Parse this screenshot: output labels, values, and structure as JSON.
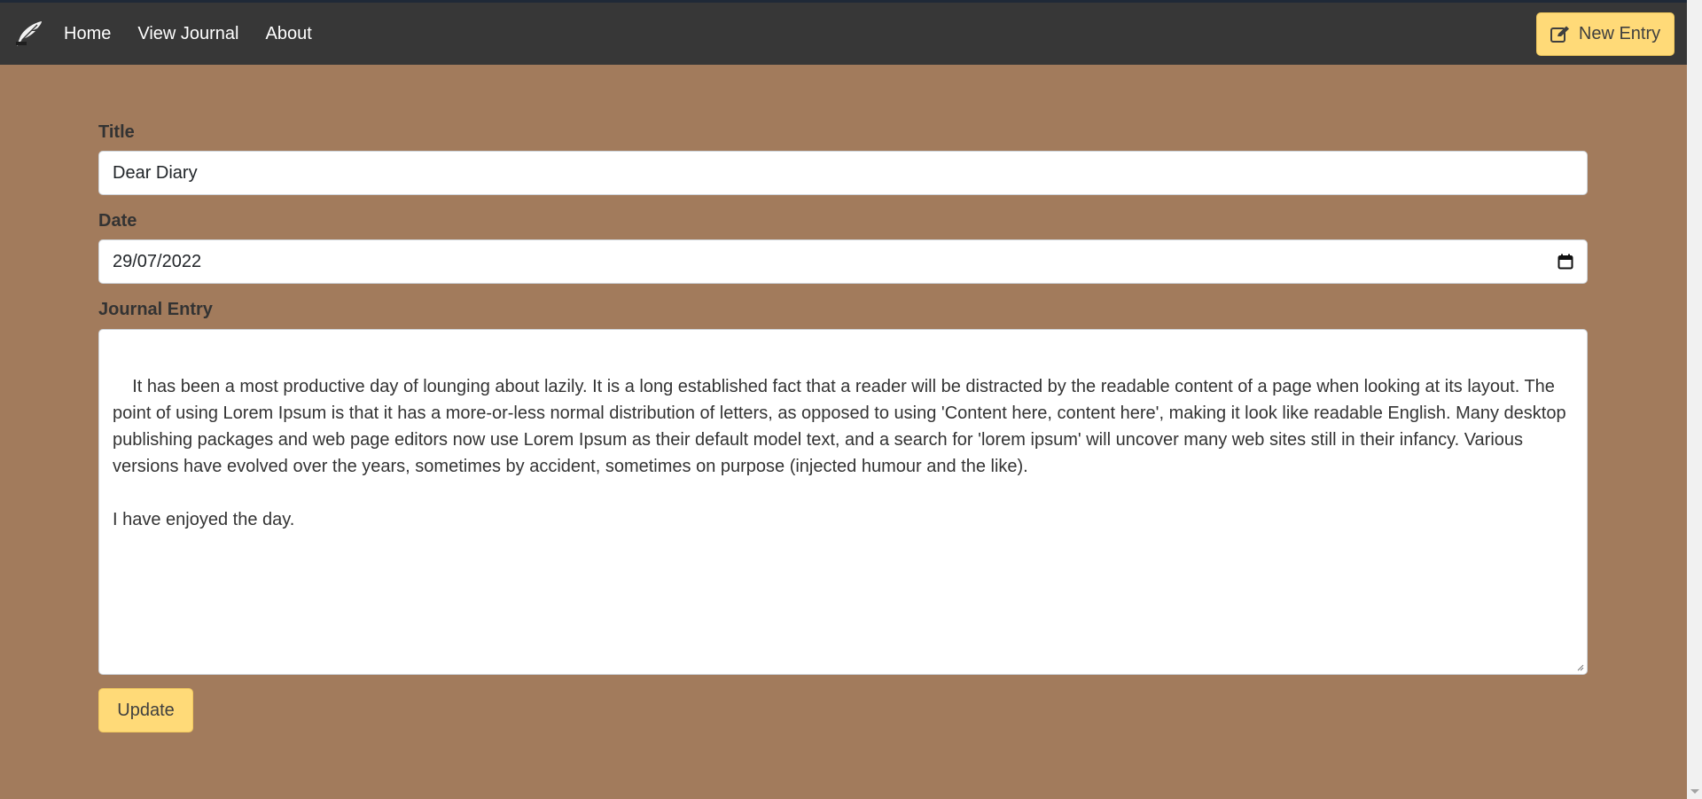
{
  "navbar": {
    "brand_icon": "feather-icon",
    "links": [
      {
        "label": "Home"
      },
      {
        "label": "View Journal"
      },
      {
        "label": "About"
      }
    ],
    "new_entry": {
      "icon": "edit-icon",
      "label": "New Entry"
    }
  },
  "form": {
    "title": {
      "label": "Title",
      "value": "Dear Diary"
    },
    "date": {
      "label": "Date",
      "value": "29/07/2022",
      "icon": "calendar-icon"
    },
    "entry": {
      "label": "Journal Entry",
      "value": "It has been a most productive day of lounging about lazily. It is a long established fact that a reader will be distracted by the readable content of a page when looking at its layout. The point of using Lorem Ipsum is that it has a more-or-less normal distribution of letters, as opposed to using 'Content here, content here', making it look like readable English. Many desktop publishing packages and web page editors now use Lorem Ipsum as their default model text, and a search for 'lorem ipsum' will uncover many web sites still in their infancy. Various versions have evolved over the years, sometimes by accident, sometimes on purpose (injected humour and the like).\n\nI have enjoyed the day."
    },
    "submit_label": "Update"
  },
  "colors": {
    "page_bg": "#a27b5c",
    "navbar_bg": "#373737",
    "button_bg": "#ffda78"
  }
}
